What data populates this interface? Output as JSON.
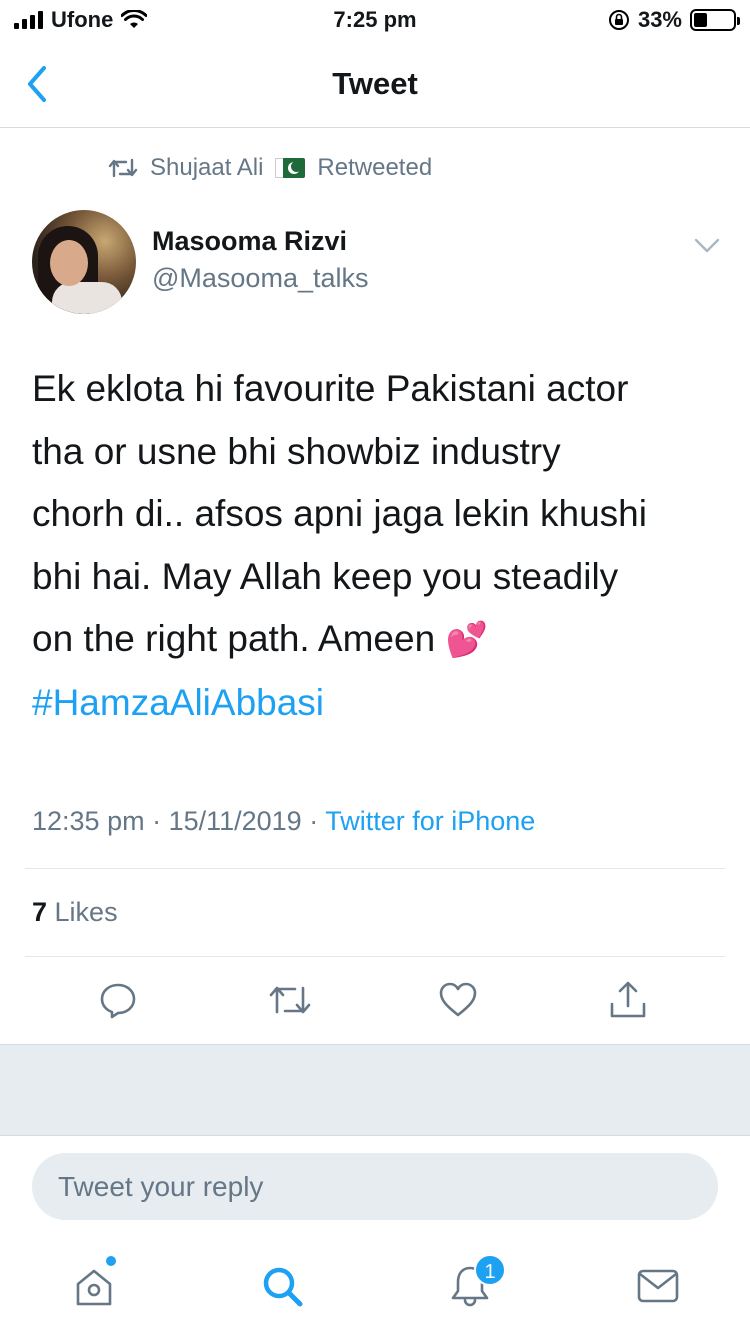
{
  "status_bar": {
    "carrier": "Ufone",
    "time": "7:25 pm",
    "battery_percent": "33%",
    "battery_level": 0.33
  },
  "nav": {
    "title": "Tweet",
    "back_icon": "chevron-left-icon"
  },
  "retweet_context": {
    "user": "Shujaat Ali",
    "flag_icon": "pakistan-flag-icon",
    "label": "Retweeted"
  },
  "tweet": {
    "author_name": "Masooma Rizvi",
    "author_handle": "@Masooma_talks",
    "text_lines": [
      "Ek eklota hi favourite Pakistani actor",
      "tha or usne bhi showbiz industry",
      "chorh di.. afsos apni jaga lekin khushi",
      "bhi hai. May Allah keep you steadily",
      "on the right path. Ameen "
    ],
    "emoji": "💕",
    "hashtag": "#HamzaAliAbbasi",
    "timestamp": "12:35 pm · 15/11/2019 · ",
    "source": "Twitter for iPhone",
    "likes_count": "7",
    "likes_label": " Likes"
  },
  "actions": [
    "reply-icon",
    "retweet-icon",
    "like-icon",
    "share-icon"
  ],
  "reply": {
    "placeholder": "Tweet your reply"
  },
  "tab_bar": {
    "items": [
      "home-icon",
      "search-icon",
      "notifications-icon",
      "messages-icon"
    ],
    "notification_badge": "1"
  },
  "colors": {
    "accent": "#1da1f2",
    "secondary_text": "#657786",
    "band": "#e6ecf0"
  }
}
